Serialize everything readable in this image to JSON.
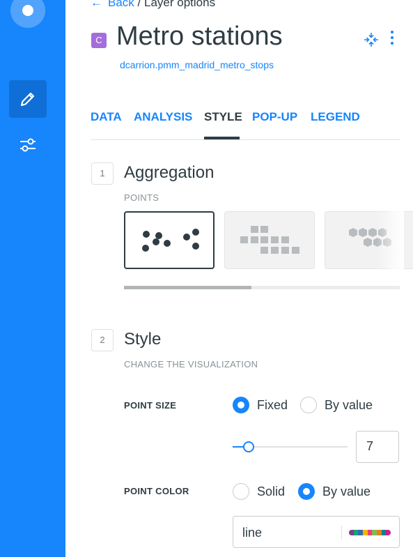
{
  "header": {
    "back_label": "Back",
    "separator": "/",
    "crumb_label": "Layer options",
    "layer_letter": "C",
    "title": "Metro stations",
    "dataset": "dcarrion.pmm_madrid_metro_stops"
  },
  "tabs": [
    {
      "label": "DATA"
    },
    {
      "label": "ANALYSIS"
    },
    {
      "label": "STYLE"
    },
    {
      "label": "POP-UP"
    },
    {
      "label": "LEGEND"
    }
  ],
  "active_tab": "STYLE",
  "aggregation": {
    "number": "1",
    "title": "Aggregation",
    "subtitle": "POINTS",
    "options": [
      "points",
      "squares",
      "hexabins"
    ],
    "selected": "points"
  },
  "style": {
    "number": "2",
    "title": "Style",
    "subtitle": "CHANGE THE VISUALIZATION",
    "point_size": {
      "label": "POINT SIZE",
      "option_fixed": "Fixed",
      "option_by_value": "By value",
      "selected": "Fixed",
      "value": "7",
      "slider_fraction": 0.14
    },
    "point_color": {
      "label": "POINT COLOR",
      "option_solid": "Solid",
      "option_by_value": "By value",
      "selected": "By value",
      "column": "line",
      "ramp_colors": [
        "#7f3c8d",
        "#11a579",
        "#3969ac",
        "#f2b701",
        "#e73f74",
        "#80ba5a",
        "#e68310",
        "#008695",
        "#cf1c90"
      ]
    }
  },
  "colors": {
    "accent": "#1785fb",
    "rail": "#1785fb",
    "text": "#2e3c43",
    "badge": "#a36edb"
  }
}
